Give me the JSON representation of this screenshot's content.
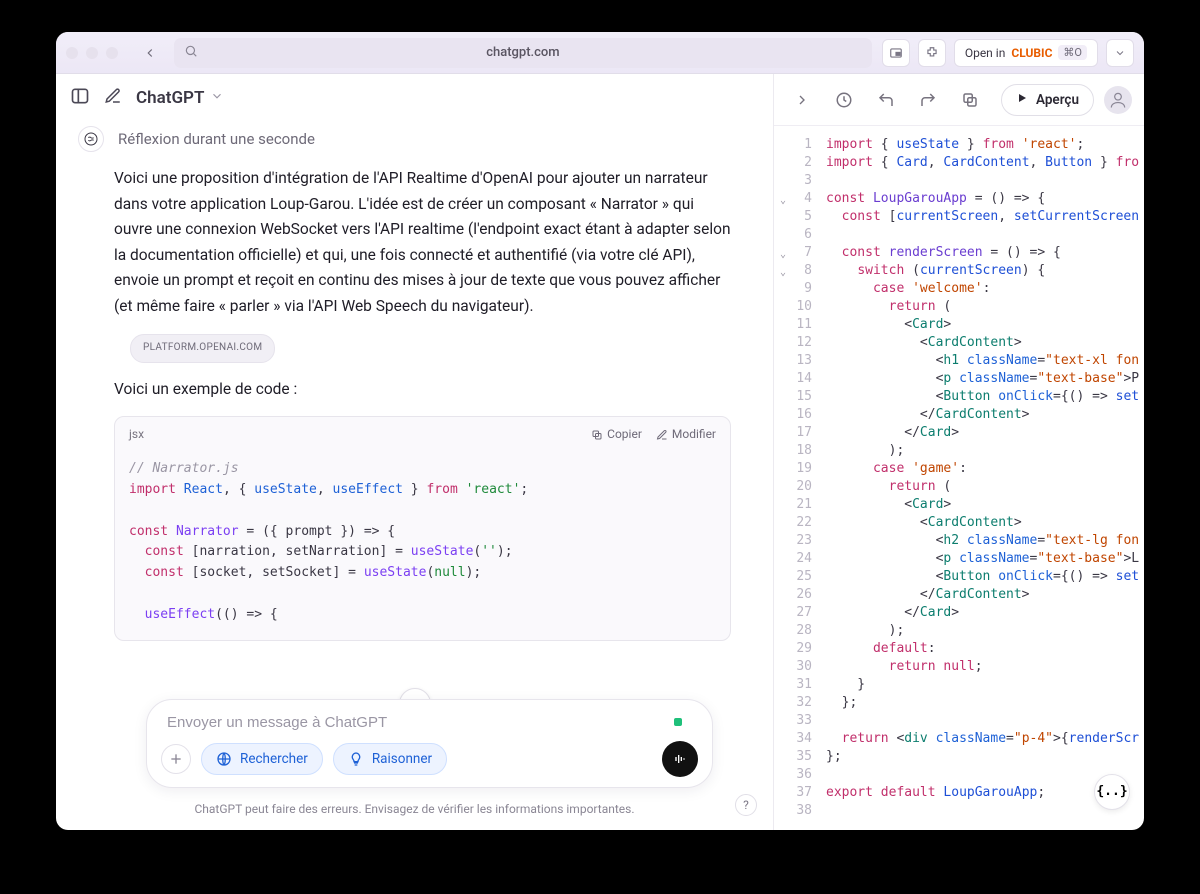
{
  "titlebar": {
    "url": "chatgpt.com",
    "open_in_prefix": "Open in",
    "open_in_brand": "CLUBIC",
    "shortcut": "⌘O"
  },
  "left": {
    "app_name": "ChatGPT",
    "thinking": "Réflexion durant une seconde",
    "body": "Voici une proposition d'intégration de l'API Realtime d'OpenAI pour ajouter un narrateur dans votre application Loup-Garou. L'idée est de créer un composant « Narrator » qui ouvre une connexion WebSocket vers l'API realtime (l'endpoint exact étant à adapter selon la documentation officielle) et qui, une fois connecté et authentifié (via votre clé API), envoie un prompt et reçoit en continu des mises à jour de texte que vous pouvez afficher (et même faire « parler » via l'API Web Speech du navigateur).",
    "source_pill": "PLATFORM.OPENAI.COM",
    "subhead": "Voici un exemple de code :",
    "codeblock": {
      "lang": "jsx",
      "copy": "Copier",
      "edit": "Modifier",
      "line_comment": "// Narrator.js",
      "l2a": "import",
      "l2b": "React",
      "l2c": ", { ",
      "l2d": "useState",
      "l2e": ", ",
      "l2f": "useEffect",
      "l2g": " } ",
      "l2h": "from",
      "l2i": "'react'",
      "l2j": ";",
      "l4a": "const",
      "l4b": "Narrator",
      "l4c": " = ({ prompt }) => {",
      "l5a": "const",
      "l5b": " [narration, setNarration] = ",
      "l5c": "useState",
      "l5d": "(",
      "l5e": "''",
      "l5f": ");",
      "l6a": "const",
      "l6b": " [socket, setSocket] = ",
      "l6c": "useState",
      "l6d": "(",
      "l6e": "null",
      "l6f": ");",
      "l8a": "useEffect",
      "l8b": "(() => {"
    },
    "composer": {
      "placeholder": "Envoyer un message à ChatGPT",
      "search": "Rechercher",
      "reason": "Raisonner"
    },
    "disclaimer": "ChatGPT peut faire des erreurs. Envisagez de vérifier les informations importantes.",
    "help": "?"
  },
  "right": {
    "preview": "Aperçu",
    "float_btn": "{..}",
    "lines": [
      {
        "n": 1,
        "seg": [
          [
            "e-kw",
            "import"
          ],
          [
            "e-plain",
            " { "
          ],
          [
            "e-id",
            "useState"
          ],
          [
            "e-plain",
            " } "
          ],
          [
            "e-kw",
            "from"
          ],
          [
            "e-plain",
            " "
          ],
          [
            "e-str",
            "'react'"
          ],
          [
            "e-plain",
            ";"
          ]
        ]
      },
      {
        "n": 2,
        "seg": [
          [
            "e-kw",
            "import"
          ],
          [
            "e-plain",
            " { "
          ],
          [
            "e-id",
            "Card"
          ],
          [
            "e-plain",
            ", "
          ],
          [
            "e-id",
            "CardContent"
          ],
          [
            "e-plain",
            ", "
          ],
          [
            "e-id",
            "Button"
          ],
          [
            "e-plain",
            " } "
          ],
          [
            "e-kw",
            "fro"
          ]
        ]
      },
      {
        "n": 3,
        "seg": []
      },
      {
        "n": 4,
        "fold": true,
        "seg": [
          [
            "e-kw",
            "const"
          ],
          [
            "e-plain",
            " "
          ],
          [
            "e-fn",
            "LoupGarouApp"
          ],
          [
            "e-plain",
            " = () => {"
          ]
        ]
      },
      {
        "n": 5,
        "seg": [
          [
            "e-plain",
            "  "
          ],
          [
            "e-kw",
            "const"
          ],
          [
            "e-plain",
            " ["
          ],
          [
            "e-id",
            "currentScreen"
          ],
          [
            "e-plain",
            ", "
          ],
          [
            "e-id",
            "setCurrentScreen"
          ]
        ]
      },
      {
        "n": 6,
        "seg": []
      },
      {
        "n": 7,
        "fold": true,
        "seg": [
          [
            "e-plain",
            "  "
          ],
          [
            "e-kw",
            "const"
          ],
          [
            "e-plain",
            " "
          ],
          [
            "e-fn",
            "renderScreen"
          ],
          [
            "e-plain",
            " = () => {"
          ]
        ]
      },
      {
        "n": 8,
        "fold": true,
        "seg": [
          [
            "e-plain",
            "    "
          ],
          [
            "e-kw",
            "switch"
          ],
          [
            "e-plain",
            " ("
          ],
          [
            "e-id",
            "currentScreen"
          ],
          [
            "e-plain",
            ") {"
          ]
        ]
      },
      {
        "n": 9,
        "seg": [
          [
            "e-plain",
            "      "
          ],
          [
            "e-kw",
            "case"
          ],
          [
            "e-plain",
            " "
          ],
          [
            "e-str",
            "'welcome'"
          ],
          [
            "e-plain",
            ":"
          ]
        ]
      },
      {
        "n": 10,
        "seg": [
          [
            "e-plain",
            "        "
          ],
          [
            "e-kw",
            "return"
          ],
          [
            "e-plain",
            " ("
          ]
        ]
      },
      {
        "n": 11,
        "seg": [
          [
            "e-plain",
            "          <"
          ],
          [
            "e-tag",
            "Card"
          ],
          [
            "e-plain",
            ">"
          ]
        ]
      },
      {
        "n": 12,
        "seg": [
          [
            "e-plain",
            "            <"
          ],
          [
            "e-tag",
            "CardContent"
          ],
          [
            "e-plain",
            ">"
          ]
        ]
      },
      {
        "n": 13,
        "seg": [
          [
            "e-plain",
            "              <"
          ],
          [
            "e-tag",
            "h1"
          ],
          [
            "e-plain",
            " "
          ],
          [
            "e-attr",
            "className"
          ],
          [
            "e-plain",
            "="
          ],
          [
            "e-str",
            "\"text-xl fon"
          ]
        ]
      },
      {
        "n": 14,
        "seg": [
          [
            "e-plain",
            "              <"
          ],
          [
            "e-tag",
            "p"
          ],
          [
            "e-plain",
            " "
          ],
          [
            "e-attr",
            "className"
          ],
          [
            "e-plain",
            "="
          ],
          [
            "e-str",
            "\"text-base\""
          ],
          [
            "e-plain",
            ">P"
          ]
        ]
      },
      {
        "n": 15,
        "seg": [
          [
            "e-plain",
            "              <"
          ],
          [
            "e-tag",
            "Button"
          ],
          [
            "e-plain",
            " "
          ],
          [
            "e-attr",
            "onClick"
          ],
          [
            "e-plain",
            "={() => "
          ],
          [
            "e-id",
            "set"
          ]
        ]
      },
      {
        "n": 16,
        "seg": [
          [
            "e-plain",
            "            </"
          ],
          [
            "e-tag",
            "CardContent"
          ],
          [
            "e-plain",
            ">"
          ]
        ]
      },
      {
        "n": 17,
        "seg": [
          [
            "e-plain",
            "          </"
          ],
          [
            "e-tag",
            "Card"
          ],
          [
            "e-plain",
            ">"
          ]
        ]
      },
      {
        "n": 18,
        "seg": [
          [
            "e-plain",
            "        );"
          ]
        ]
      },
      {
        "n": 19,
        "seg": [
          [
            "e-plain",
            "      "
          ],
          [
            "e-kw",
            "case"
          ],
          [
            "e-plain",
            " "
          ],
          [
            "e-str",
            "'game'"
          ],
          [
            "e-plain",
            ":"
          ]
        ]
      },
      {
        "n": 20,
        "seg": [
          [
            "e-plain",
            "        "
          ],
          [
            "e-kw",
            "return"
          ],
          [
            "e-plain",
            " ("
          ]
        ]
      },
      {
        "n": 21,
        "seg": [
          [
            "e-plain",
            "          <"
          ],
          [
            "e-tag",
            "Card"
          ],
          [
            "e-plain",
            ">"
          ]
        ]
      },
      {
        "n": 22,
        "seg": [
          [
            "e-plain",
            "            <"
          ],
          [
            "e-tag",
            "CardContent"
          ],
          [
            "e-plain",
            ">"
          ]
        ]
      },
      {
        "n": 23,
        "seg": [
          [
            "e-plain",
            "              <"
          ],
          [
            "e-tag",
            "h2"
          ],
          [
            "e-plain",
            " "
          ],
          [
            "e-attr",
            "className"
          ],
          [
            "e-plain",
            "="
          ],
          [
            "e-str",
            "\"text-lg fon"
          ]
        ]
      },
      {
        "n": 24,
        "seg": [
          [
            "e-plain",
            "              <"
          ],
          [
            "e-tag",
            "p"
          ],
          [
            "e-plain",
            " "
          ],
          [
            "e-attr",
            "className"
          ],
          [
            "e-plain",
            "="
          ],
          [
            "e-str",
            "\"text-base\""
          ],
          [
            "e-plain",
            ">L"
          ]
        ]
      },
      {
        "n": 25,
        "seg": [
          [
            "e-plain",
            "              <"
          ],
          [
            "e-tag",
            "Button"
          ],
          [
            "e-plain",
            " "
          ],
          [
            "e-attr",
            "onClick"
          ],
          [
            "e-plain",
            "={() => "
          ],
          [
            "e-id",
            "set"
          ]
        ]
      },
      {
        "n": 26,
        "seg": [
          [
            "e-plain",
            "            </"
          ],
          [
            "e-tag",
            "CardContent"
          ],
          [
            "e-plain",
            ">"
          ]
        ]
      },
      {
        "n": 27,
        "seg": [
          [
            "e-plain",
            "          </"
          ],
          [
            "e-tag",
            "Card"
          ],
          [
            "e-plain",
            ">"
          ]
        ]
      },
      {
        "n": 28,
        "seg": [
          [
            "e-plain",
            "        );"
          ]
        ]
      },
      {
        "n": 29,
        "seg": [
          [
            "e-plain",
            "      "
          ],
          [
            "e-kw",
            "default"
          ],
          [
            "e-plain",
            ":"
          ]
        ]
      },
      {
        "n": 30,
        "seg": [
          [
            "e-plain",
            "        "
          ],
          [
            "e-kw",
            "return"
          ],
          [
            "e-plain",
            " "
          ],
          [
            "e-kw",
            "null"
          ],
          [
            "e-plain",
            ";"
          ]
        ]
      },
      {
        "n": 31,
        "seg": [
          [
            "e-plain",
            "    }"
          ]
        ]
      },
      {
        "n": 32,
        "seg": [
          [
            "e-plain",
            "  };"
          ]
        ]
      },
      {
        "n": 33,
        "seg": []
      },
      {
        "n": 34,
        "seg": [
          [
            "e-plain",
            "  "
          ],
          [
            "e-kw",
            "return"
          ],
          [
            "e-plain",
            " <"
          ],
          [
            "e-tag",
            "div"
          ],
          [
            "e-plain",
            " "
          ],
          [
            "e-attr",
            "className"
          ],
          [
            "e-plain",
            "="
          ],
          [
            "e-str",
            "\"p-4\""
          ],
          [
            "e-plain",
            ">{"
          ],
          [
            "e-id",
            "renderScr"
          ]
        ]
      },
      {
        "n": 35,
        "seg": [
          [
            "e-plain",
            "};"
          ]
        ]
      },
      {
        "n": 36,
        "seg": []
      },
      {
        "n": 37,
        "seg": [
          [
            "e-kw",
            "export"
          ],
          [
            "e-plain",
            " "
          ],
          [
            "e-kw",
            "default"
          ],
          [
            "e-plain",
            " "
          ],
          [
            "e-id",
            "LoupGarouApp"
          ],
          [
            "e-plain",
            ";"
          ]
        ]
      },
      {
        "n": 38,
        "seg": []
      }
    ]
  }
}
